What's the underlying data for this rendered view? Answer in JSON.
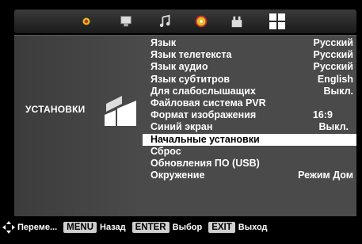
{
  "top_icons": [
    {
      "icon": "picture-icon",
      "active": false
    },
    {
      "icon": "channel-icon",
      "active": false
    },
    {
      "icon": "music-icon",
      "active": false
    },
    {
      "icon": "timer-icon",
      "active": false
    },
    {
      "icon": "lock-icon",
      "active": false
    },
    {
      "icon": "setup-icon",
      "active": true
    }
  ],
  "section": {
    "title": "УСТАНОВКИ",
    "icon": "setup-icon"
  },
  "menu_items": [
    {
      "label": "Язык",
      "value": "Русский",
      "selected": false
    },
    {
      "label": "Язык телетекста",
      "value": "Русский",
      "selected": false
    },
    {
      "label": "Язык аудио",
      "value": "Русский",
      "selected": false
    },
    {
      "label": "Язык субтитров",
      "value": "English",
      "selected": false
    },
    {
      "label": "Для слабослышащих",
      "value": "Выкл.",
      "selected": false
    },
    {
      "label": "Файловая система PVR",
      "value": "",
      "selected": false
    },
    {
      "label": "Формат изображения",
      "value": "16:9",
      "selected": false
    },
    {
      "label": "Синий экран",
      "value": "Выкл.",
      "selected": false
    },
    {
      "label": "Начальные установки",
      "value": "",
      "selected": true
    },
    {
      "label": "Сброс",
      "value": "",
      "selected": false
    },
    {
      "label": "Обновления ПО (USB)",
      "value": "",
      "selected": false
    },
    {
      "label": "Окружение",
      "value": "Режим Дом",
      "selected": false
    }
  ],
  "bottom": {
    "nav_text": "Переме...",
    "menu_key": "MENU",
    "menu_text": "Назад",
    "enter_key": "ENTER",
    "enter_text": "Выбор",
    "exit_key": "EXIT",
    "exit_text": "Выход"
  },
  "colors": {
    "panel": "#4a4a4a",
    "selected_bg": "#ffffff",
    "text": "#ffffff",
    "accent_yellow": "#e0c020",
    "accent_red": "#d03030"
  }
}
